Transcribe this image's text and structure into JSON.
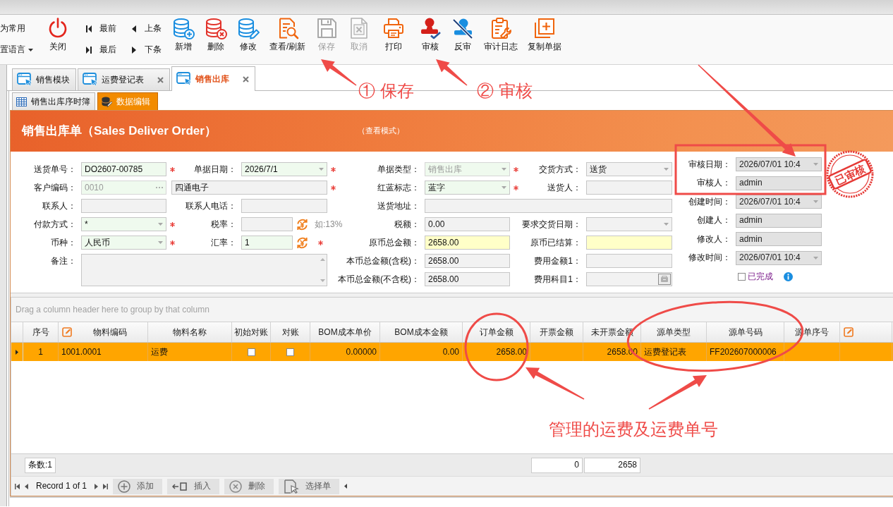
{
  "toolbar": {
    "menu": [
      {
        "label": "为常用",
        "caret": false
      },
      {
        "label": "置语言",
        "caret": true
      }
    ],
    "buttons": [
      {
        "kind": "large",
        "label": "关闭",
        "disabled": false
      },
      {
        "kind": "small",
        "label": "最前",
        "disabled": false
      },
      {
        "kind": "small",
        "label": "最后",
        "disabled": false
      },
      {
        "kind": "small",
        "label": "上条",
        "disabled": false
      },
      {
        "kind": "small",
        "label": "下条",
        "disabled": false
      },
      {
        "kind": "large",
        "label": "新增",
        "disabled": false
      },
      {
        "kind": "large",
        "label": "删除",
        "disabled": false
      },
      {
        "kind": "large",
        "label": "修改",
        "disabled": false
      },
      {
        "kind": "large",
        "label": "查看/刷新",
        "disabled": false
      },
      {
        "kind": "large",
        "label": "保存",
        "disabled": true
      },
      {
        "kind": "large",
        "label": "取消",
        "disabled": true
      },
      {
        "kind": "large",
        "label": "打印",
        "disabled": false
      },
      {
        "kind": "large",
        "label": "审核",
        "disabled": false
      },
      {
        "kind": "large",
        "label": "反审",
        "disabled": false
      },
      {
        "kind": "large",
        "label": "审计日志",
        "disabled": false
      },
      {
        "kind": "large",
        "label": "复制单据",
        "disabled": false
      }
    ]
  },
  "document_tabs": [
    {
      "label": "销售模块",
      "closable": false,
      "selected": false
    },
    {
      "label": "运费登记表",
      "closable": true,
      "selected": false
    },
    {
      "label": "销售出库",
      "closable": true,
      "selected": true
    }
  ],
  "sub_tabs": [
    {
      "label": "销售出库序时簿",
      "selected": false
    },
    {
      "label": "数据编辑",
      "selected": true
    }
  ],
  "form_header": {
    "title": "销售出库单（Sales Deliver Order）",
    "mode": "（查看模式）"
  },
  "form": {
    "fields": [
      {
        "label": "送货单号：",
        "value": "DO2607-00785",
        "kind": "text",
        "color": "#effaee",
        "required": true,
        "disabled": false
      },
      {
        "label": "单据日期：",
        "value": "2026/7/1",
        "kind": "combo",
        "color": "#effaee",
        "required": true,
        "disabled": false
      },
      {
        "label": "单据类型：",
        "value": "销售出库",
        "kind": "combo",
        "color": "#effaee",
        "required": true,
        "disabled": true
      },
      {
        "label": "交货方式：",
        "value": "送货",
        "kind": "combo",
        "color": "#f2f2f2",
        "required": false,
        "disabled": false
      },
      {
        "label": "客户编码：",
        "value": "0010",
        "kind": "lookup",
        "color": "#effaee",
        "required": false,
        "disabled": true
      },
      {
        "value": "四通电子",
        "kind": "text",
        "color": "#f2f2f2",
        "required": true,
        "disabled": false
      },
      {
        "label": "红蓝标志：",
        "value": "蓝字",
        "kind": "combo",
        "color": "#effaee",
        "required": true,
        "disabled": false
      },
      {
        "label": "送货人：",
        "kind": "text",
        "color": "#f2f2f2",
        "required": false,
        "disabled": false
      },
      {
        "label": "联系人：",
        "kind": "text",
        "color": "#f2f2f2",
        "required": false,
        "disabled": false
      },
      {
        "label": "联系人电话：",
        "kind": "text",
        "color": "#f2f2f2",
        "required": false,
        "disabled": false
      },
      {
        "label": "送货地址：",
        "kind": "text",
        "color": "#f2f2f2",
        "required": false,
        "disabled": false
      },
      {
        "label": "付款方式：",
        "value": "*",
        "kind": "combo",
        "color": "#effaee",
        "required": true,
        "disabled": false
      },
      {
        "label": "税率：",
        "kind": "text",
        "color": "#f2f2f2",
        "required": false,
        "disabled": false,
        "rate_button": true,
        "hint": "如:13%"
      },
      {
        "label": "税额：",
        "value": "0.00",
        "kind": "text",
        "color": "#f2f2f2",
        "required": false,
        "disabled": false
      },
      {
        "label": "要求交货日期：",
        "kind": "combo",
        "color": "#f2f2f2",
        "required": false,
        "disabled": false
      },
      {
        "label": "币种：",
        "value": "人民币",
        "kind": "combo",
        "color": "#effaee",
        "required": true,
        "disabled": false
      },
      {
        "label": "汇率：",
        "value": "1",
        "kind": "text",
        "color": "#effaee",
        "required": true,
        "disabled": false,
        "rate_button": true
      },
      {
        "label": "原币总金额：",
        "value": "2658.00",
        "kind": "text",
        "color": "#ffffc8",
        "required": false,
        "disabled": false
      },
      {
        "label": "原币已结算：",
        "kind": "text",
        "color": "#ffffc8",
        "required": false,
        "disabled": false
      },
      {
        "label": "备注：",
        "kind": "memo",
        "color": "#f2f2f2",
        "required": false,
        "disabled": false
      },
      {
        "label": "本币总金额(含税)：",
        "value": "2658.00",
        "kind": "text",
        "color": "#f2f2f2",
        "required": false,
        "disabled": false
      },
      {
        "label": "费用金额1：",
        "kind": "text",
        "color": "#f2f2f2",
        "required": false,
        "disabled": false
      },
      {
        "label": "本币总金额(不含税)：",
        "value": "2658.00",
        "kind": "text",
        "color": "#f2f2f2",
        "required": false,
        "disabled": false
      },
      {
        "label": "费用科目1：",
        "kind": "picker",
        "color": "#f2f2f2",
        "required": false,
        "disabled": false
      }
    ]
  },
  "audit": {
    "fields": [
      {
        "label": "审核日期：",
        "value": "2026/07/01 10:4",
        "kind": "combo"
      },
      {
        "label": "审核人：",
        "value": "admin",
        "kind": "text"
      },
      {
        "label": "创建时间：",
        "value": "2026/07/01 10:4",
        "kind": "combo"
      },
      {
        "label": "创建人：",
        "value": "admin",
        "kind": "text"
      },
      {
        "label": "修改人：",
        "value": "admin",
        "kind": "text"
      },
      {
        "label": "修改时间：",
        "value": "2026/07/01 10:4",
        "kind": "combo"
      }
    ],
    "completed": {
      "label": "已完成",
      "checked": false
    },
    "stamp": "已审核"
  },
  "grid": {
    "group_hint": "Drag a column header here to group by that column",
    "columns": [
      {
        "label": "序号",
        "kind": "index",
        "edit_icon": false,
        "summary": "条数:1"
      },
      {
        "label": "物料编码",
        "kind": "text",
        "edit_icon": true
      },
      {
        "label": "物料名称",
        "kind": "text",
        "edit_icon": false
      },
      {
        "label": "初始对账",
        "kind": "check",
        "edit_icon": false
      },
      {
        "label": "对账",
        "kind": "check",
        "edit_icon": false
      },
      {
        "label": "BOM成本单价",
        "kind": "number",
        "edit_icon": false
      },
      {
        "label": "BOM成本金额",
        "kind": "number",
        "edit_icon": false
      },
      {
        "label": "订单金额",
        "kind": "number",
        "edit_icon": false
      },
      {
        "label": "开票金额",
        "kind": "number",
        "edit_icon": false,
        "summary": "0"
      },
      {
        "label": "未开票金额",
        "kind": "number",
        "edit_icon": false,
        "summary": "2658"
      },
      {
        "label": "源单类型",
        "kind": "text",
        "edit_icon": false
      },
      {
        "label": "源单号码",
        "kind": "text",
        "edit_icon": false
      },
      {
        "label": "源单序号",
        "kind": "text",
        "edit_icon": false
      },
      {
        "kind": "filler",
        "edit_icon": true
      }
    ],
    "rows": [
      {
        "selected": true,
        "cells": [
          "1",
          "1001.0001",
          "运费",
          {
            "checked": false
          },
          {
            "checked": false
          },
          "0.00000",
          "0.00",
          "2658.00",
          null,
          "2658.00",
          "运费登记表",
          "FF202607000006",
          null,
          null
        ]
      }
    ]
  },
  "navigator": {
    "record": "Record 1 of 1",
    "buttons": [
      {
        "label": "添加"
      },
      {
        "label": "插入"
      },
      {
        "label": "删除"
      },
      {
        "label": "选择单"
      }
    ]
  },
  "annotations": [
    {
      "text": "① 保存"
    },
    {
      "text": "② 审核"
    },
    {
      "text": "管理的运费及运费单号"
    }
  ]
}
